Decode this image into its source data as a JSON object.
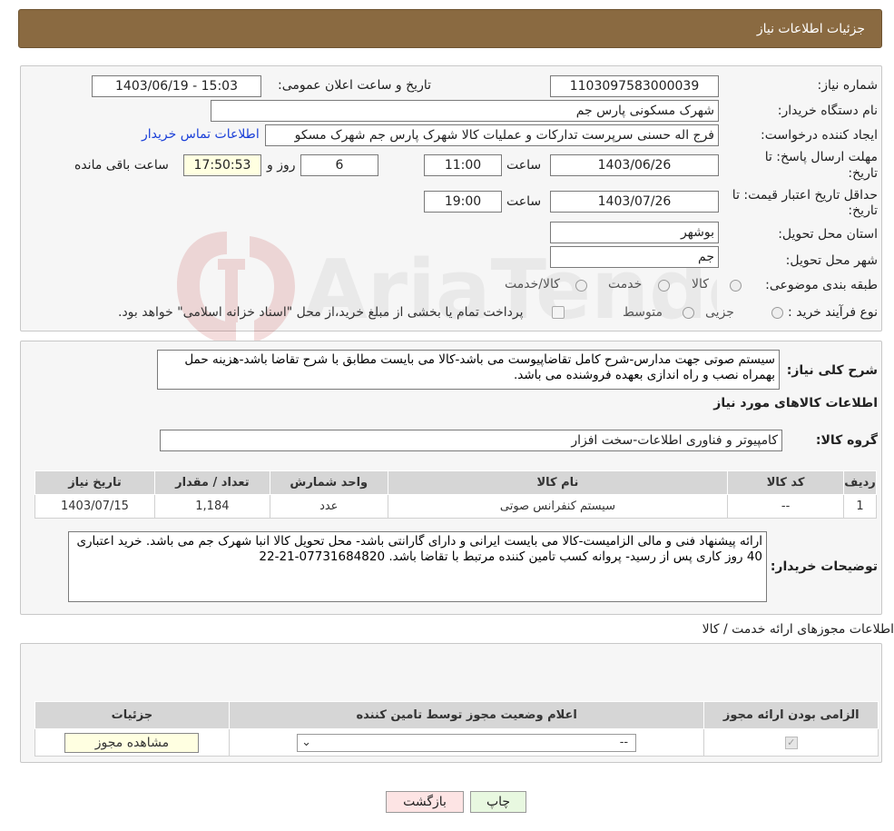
{
  "header": {
    "title": "جزئیات اطلاعات نیاز"
  },
  "need_info": {
    "need_number_label": "شماره نیاز:",
    "need_number": "1103097583000039",
    "announce_label": "تاریخ و ساعت اعلان عمومی:",
    "announce_value": "1403/06/19 - 15:03",
    "buyer_org_label": "نام دستگاه خریدار:",
    "buyer_org": "شهرک مسکونی پارس جم",
    "creator_label": "ایجاد کننده درخواست:",
    "creator": "فرج اله حسنی سرپرست تداركات و عمليات كالا شهرک پارس جم شهرک مسکو",
    "contact_link": "اطلاعات تماس خریدار",
    "deadline_label_1": "مهلت ارسال پاسخ: تا",
    "deadline_label_2": "تاریخ:",
    "deadline_date": "1403/06/26",
    "time_label": "ساعت",
    "deadline_time": "11:00",
    "days": "6",
    "days_label": "روز و",
    "remaining_time": "17:50:53",
    "remaining_label": "ساعت باقی مانده",
    "validity_label_1": "حداقل تاریخ اعتبار قیمت: تا",
    "validity_label_2": "تاریخ:",
    "validity_date": "1403/07/26",
    "validity_time": "19:00",
    "province_label": "استان محل تحویل:",
    "province": "بوشهر",
    "city_label": "شهر محل تحویل:",
    "city": "جم",
    "category_label": "طبقه بندی موضوعی:",
    "category_options": [
      "کالا",
      "خدمت",
      "کالا/خدمت"
    ],
    "process_label": "نوع فرآیند خرید :",
    "process_options": [
      "جزیی",
      "متوسط"
    ],
    "process_note": "پرداخت تمام یا بخشی از مبلغ خرید،از محل \"اسناد خزانه اسلامی\" خواهد بود."
  },
  "description": {
    "label": "شرح کلی نیاز:",
    "text": "سیستم صوتی جهت مدارس-شرح کامل تقاضاپیوست می باشد-کالا می بایست مطابق با شرح تقاضا باشد-هزینه حمل بهمراه نصب و راه اندازی بعهده فروشنده می باشد.",
    "goods_title": "اطلاعات کالاهای مورد نیاز",
    "group_label": "گروه کالا:",
    "group_value": "کامپیوتر و فناوری اطلاعات-سخت افزار"
  },
  "goods_table": {
    "headers": [
      "ردیف",
      "کد کالا",
      "نام کالا",
      "واحد شمارش",
      "تعداد / مقدار",
      "تاریخ نیاز"
    ],
    "rows": [
      {
        "row": "1",
        "code": "--",
        "name": "سیستم کنفرانس صوتی",
        "unit": "عدد",
        "qty": "1,184",
        "date": "1403/07/15"
      }
    ]
  },
  "buyer_notes": {
    "label": "توضیحات خریدار:",
    "text": "ارائه پیشنهاد فنی و مالی الزامیست-کالا می بایست ایرانی و دارای گارانتی باشد- محل تحویل کالا انبا شهرک جم می باشد. خرید اعتباری 40 روز کاری پس از رسید- پروانه کسب تامین کننده مرتبط با تقاضا باشد. 07731684820-21-22"
  },
  "licenses": {
    "title": "اطلاعات مجوزهای ارائه خدمت / کالا",
    "headers": [
      "الزامی بودن ارائه مجوز",
      "اعلام وضعیت مجوز توسط تامین کننده",
      "جزئیات"
    ],
    "select_value": "--",
    "view_button": "مشاهده مجوز"
  },
  "footer": {
    "print_button": "چاپ",
    "back_button": "بازگشت"
  },
  "watermark": {
    "text": "AriaTender.neT"
  },
  "colors": {
    "header": "#8a6a41",
    "link": "#1a3fd8",
    "back_button": "#fde4e4",
    "print_button": "#e8f8e0",
    "yellow_field": "#ffffe1"
  }
}
